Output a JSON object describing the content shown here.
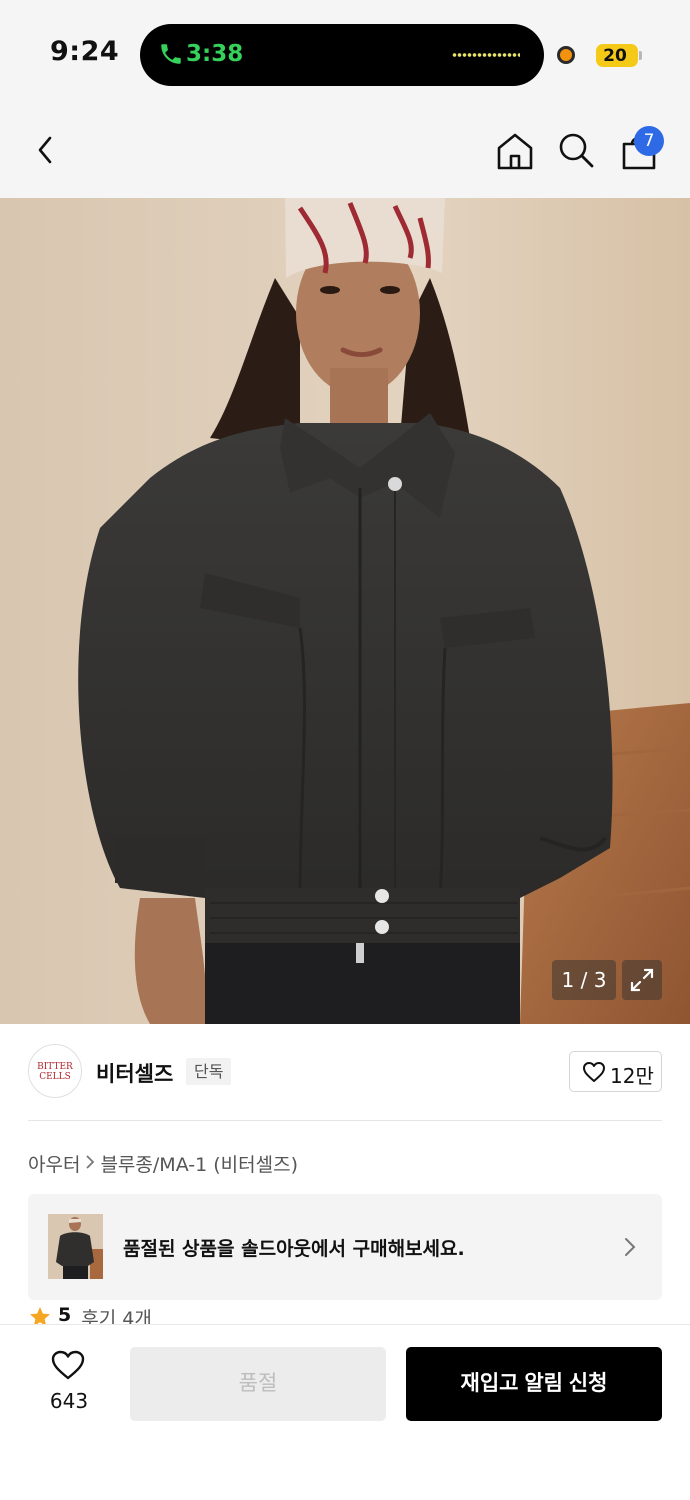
{
  "status_bar": {
    "time": "9:24",
    "call_time": "3:38",
    "battery": "20",
    "colors": {
      "call": "#35d15b",
      "battery": "#f5c918",
      "recording": "#f2920f"
    }
  },
  "nav": {
    "icons": [
      "back-icon",
      "home-icon",
      "search-icon",
      "cart-icon"
    ],
    "cart_badge": "7",
    "badge_color": "#2f6ae6"
  },
  "product_image": {
    "counter": "1 / 3",
    "icons": [
      "expand-icon"
    ]
  },
  "brand": {
    "logo_line1": "BITTER",
    "logo_line2": "CELLS",
    "name": "비터셀즈",
    "badge": "단독",
    "like_count": "12만",
    "logo_color": "#b0272d"
  },
  "breadcrumb": {
    "category": "아우터",
    "subcategory": "블루종/MA-1 (비터셀즈)"
  },
  "soldout_banner": {
    "text": "품절된 상품을 솔드아웃에서 구매해보세요."
  },
  "rating": {
    "score": "5",
    "reviews": "후기 4개",
    "star_color": "#f5a623"
  },
  "bottom_bar": {
    "wish_count": "643",
    "soldout_label": "품절",
    "restock_label": "재입고 알림 신청"
  }
}
